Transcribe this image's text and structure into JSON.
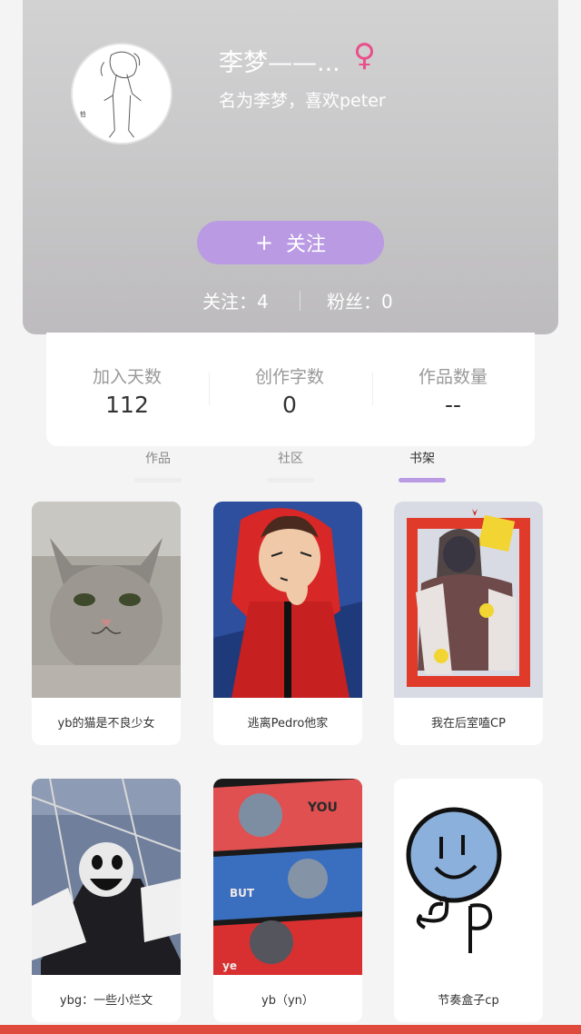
{
  "profile": {
    "name": "李梦——...",
    "gender_icon": "female-icon",
    "bio": "名为李梦，喜欢peter",
    "follow_button": {
      "plus": "+",
      "label": "关注"
    },
    "following": "关注：4",
    "fans": "粉丝：0"
  },
  "stats": [
    {
      "label": "加入天数",
      "value": "112"
    },
    {
      "label": "创作字数",
      "value": "0"
    },
    {
      "label": "作品数量",
      "value": "--"
    }
  ],
  "tabs": [
    {
      "label": "作品",
      "active": false
    },
    {
      "label": "社区",
      "active": false
    },
    {
      "label": "书架",
      "active": true
    }
  ],
  "books": [
    {
      "title": "yb的猫是不良少女"
    },
    {
      "title": "逃离Pedro他家"
    },
    {
      "title": "我在后室嗑CP"
    },
    {
      "title": "ybg：一些小烂文"
    },
    {
      "title": "yb（yn）"
    },
    {
      "title": "节奏盒子cp"
    }
  ],
  "colors": {
    "accent": "#b99ae3",
    "gender": "#e94e8a",
    "bottom_strip": "#e04a3c"
  }
}
